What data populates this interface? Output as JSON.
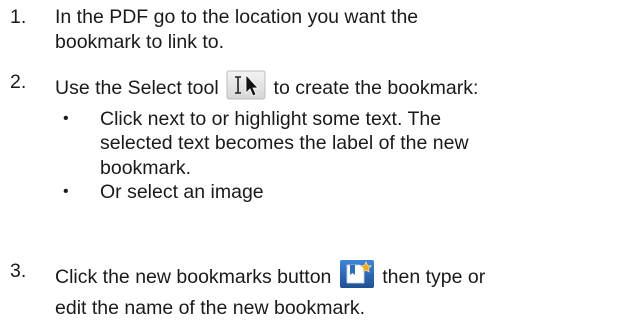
{
  "steps": [
    {
      "number": "1.",
      "lines": [
        "In the PDF go to the location you want the",
        "bookmark to link to."
      ]
    },
    {
      "number": "2.",
      "text_before_icon": "Use the Select tool",
      "icon": "select-tool-icon",
      "text_after_icon": "to create the bookmark:",
      "bullets": [
        {
          "lines": [
            "Click next to or highlight some text. The",
            "selected text becomes the label of the new",
            "bookmark."
          ]
        },
        {
          "lines": [
            "Or select an image"
          ]
        }
      ]
    },
    {
      "number": "3.",
      "text_before_icon": "Click the new bookmarks button",
      "icon": "new-bookmark-icon",
      "text_after_icon": "then type or",
      "line2": "edit the name of the new bookmark."
    }
  ],
  "bullet_char": "•",
  "colors": {
    "text": "#1a1a1a",
    "new_bookmark_blue": "#2f6db5",
    "new_bookmark_star": "#f5a623"
  }
}
